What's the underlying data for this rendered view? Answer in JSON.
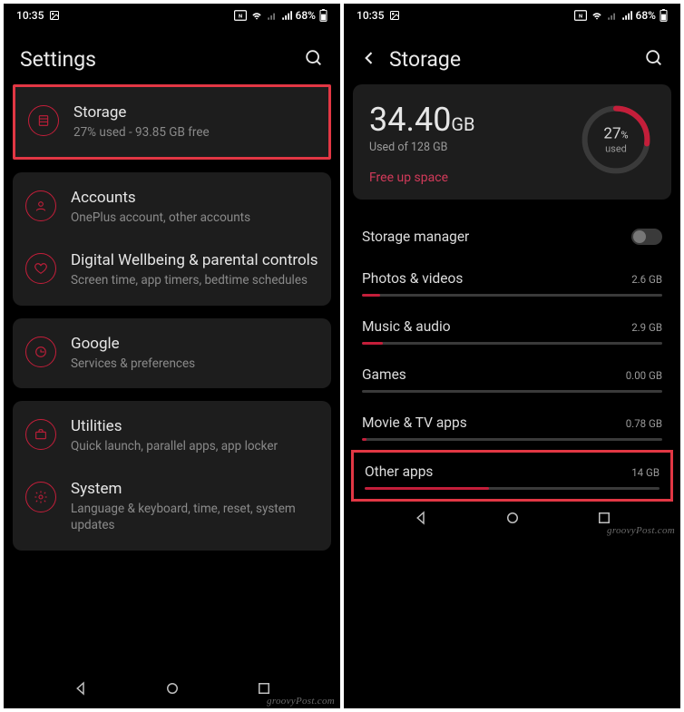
{
  "status": {
    "time": "10:35",
    "battery": "68%"
  },
  "leftScreen": {
    "header": {
      "title": "Settings"
    },
    "groups": [
      {
        "highlighted": true,
        "items": [
          {
            "icon": "storage",
            "title": "Storage",
            "sub": "27% used - 93.85 GB free"
          }
        ]
      },
      {
        "items": [
          {
            "icon": "account",
            "title": "Accounts",
            "sub": "OnePlus account, other accounts"
          },
          {
            "icon": "heart",
            "title": "Digital Wellbeing & parental controls",
            "sub": "Screen time, app timers, bedtime schedules"
          }
        ]
      },
      {
        "items": [
          {
            "icon": "google",
            "title": "Google",
            "sub": "Services & preferences"
          }
        ]
      },
      {
        "items": [
          {
            "icon": "briefcase",
            "title": "Utilities",
            "sub": "Quick launch, parallel apps, app locker"
          },
          {
            "icon": "gear",
            "title": "System",
            "sub": "Language & keyboard, time, reset, system updates"
          }
        ]
      }
    ]
  },
  "rightScreen": {
    "header": {
      "title": "Storage"
    },
    "summary": {
      "value": "34.40",
      "unit": "GB",
      "sub": "Used of 128 GB",
      "freeup": "Free up space",
      "ring": {
        "percent": "27",
        "percentSuffix": "%",
        "usedLabel": "used",
        "progress": 27
      }
    },
    "storageManager": {
      "label": "Storage manager",
      "on": false
    },
    "categories": [
      {
        "title": "Photos & videos",
        "size": "2.6 GB",
        "fill": 6
      },
      {
        "title": "Music & audio",
        "size": "2.9 GB",
        "fill": 7
      },
      {
        "title": "Games",
        "size": "0.00 GB",
        "fill": 0
      },
      {
        "title": "Movie & TV apps",
        "size": "0.78 GB",
        "fill": 1.5
      },
      {
        "title": "Other apps",
        "size": "14 GB",
        "fill": 42,
        "highlighted": true
      }
    ]
  },
  "watermark": "groovyPost.com"
}
